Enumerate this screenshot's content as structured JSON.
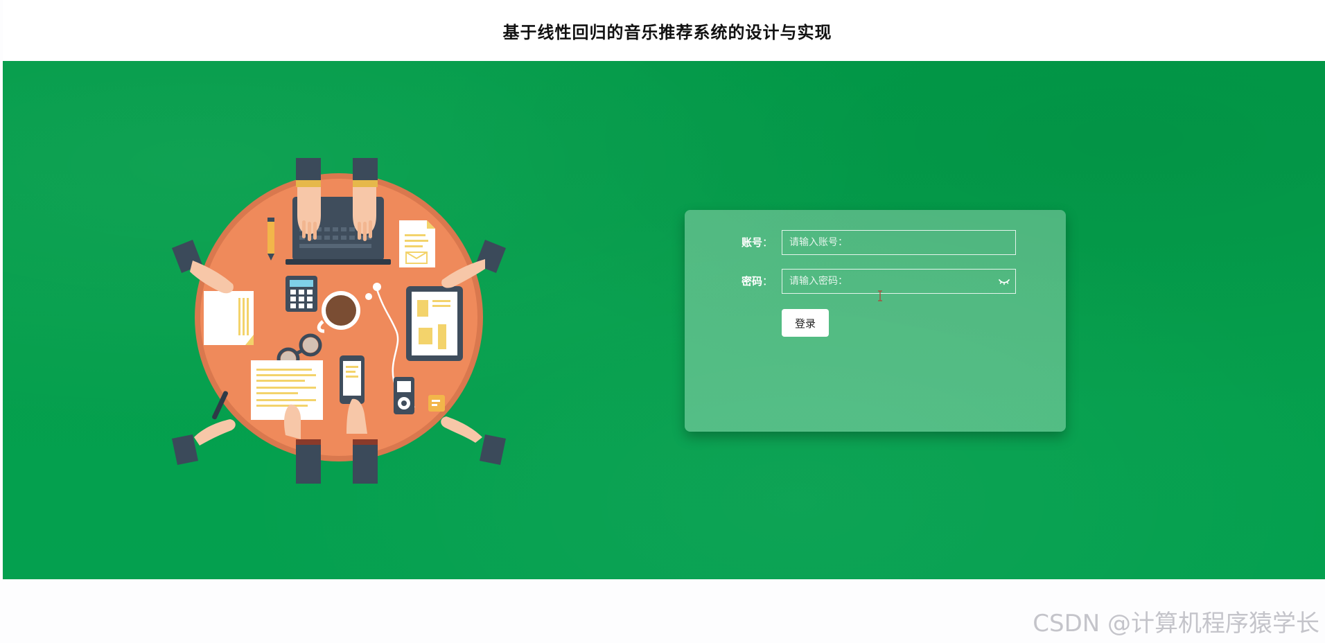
{
  "header": {
    "title": "基于线性回归的音乐推荐系统的设计与实现"
  },
  "login": {
    "account_label": "账号",
    "account_colon": "：",
    "account_placeholder": "请输入账号：",
    "password_label": "密码",
    "password_colon": "：",
    "password_placeholder": "请输入密码：",
    "login_button": "登录"
  },
  "watermark": "CSDN @计算机程序猿学长",
  "colors": {
    "banner": "#029c49",
    "table": "#ef8a5b",
    "table_rim": "#d9784e",
    "sleeve": "#3b4a5a",
    "skin": "#f7c7a8"
  },
  "icons": {
    "password_toggle": "eye-closed-icon",
    "text_cursor": "i-beam-cursor-icon"
  }
}
